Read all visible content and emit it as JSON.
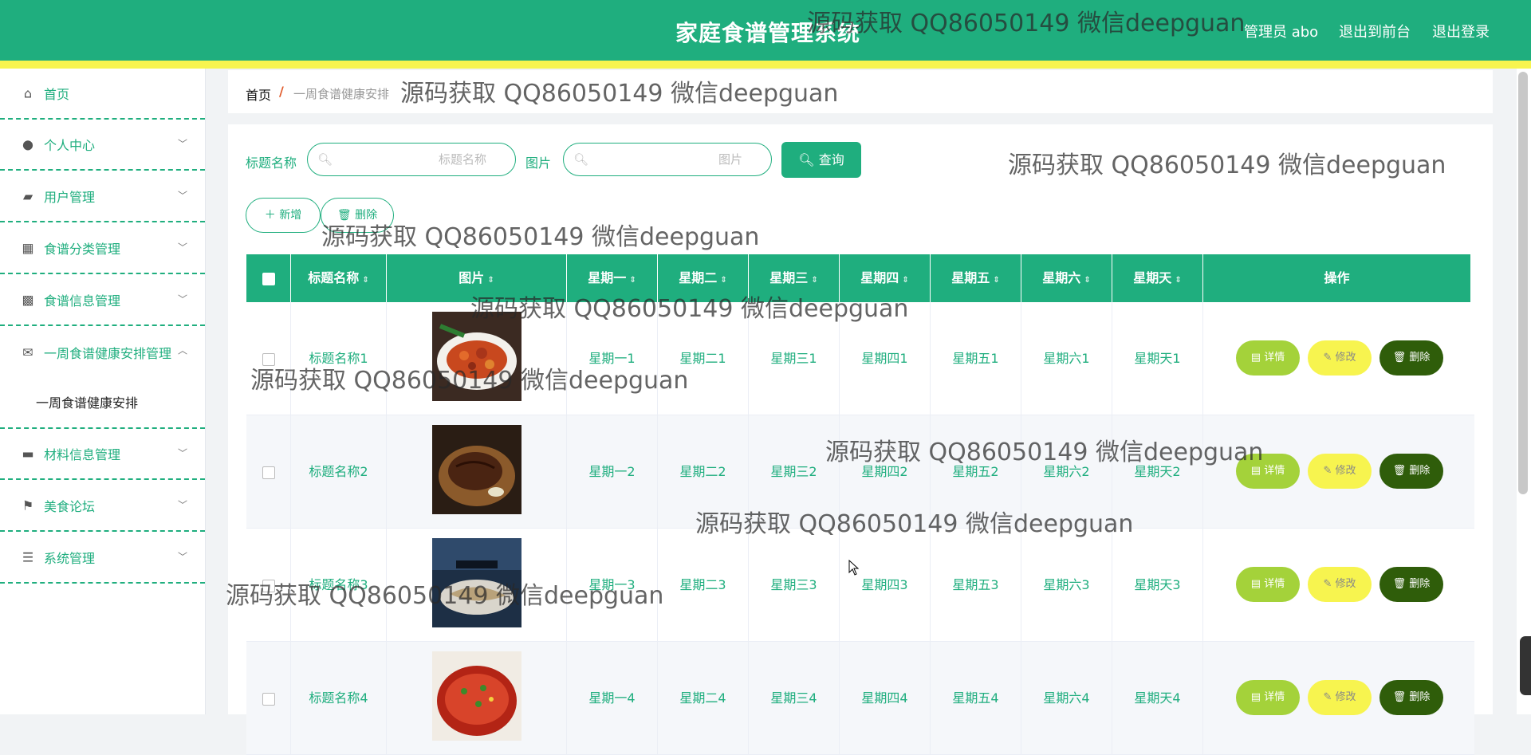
{
  "header": {
    "title": "家庭食谱管理系统",
    "admin": "管理员 abo",
    "to_front": "退出到前台",
    "logout": "退出登录"
  },
  "sidebar": {
    "items": [
      {
        "label": "首页",
        "icon": "home-icon"
      },
      {
        "label": "个人中心",
        "icon": "user-icon"
      },
      {
        "label": "用户管理",
        "icon": "wallet-icon"
      },
      {
        "label": "食谱分类管理",
        "icon": "grid-icon"
      },
      {
        "label": "食谱信息管理",
        "icon": "apps-icon"
      },
      {
        "label": "一周食谱健康安排管理",
        "icon": "mail-icon"
      },
      {
        "label": "材料信息管理",
        "icon": "briefcase-icon"
      },
      {
        "label": "美食论坛",
        "icon": "flag-icon"
      },
      {
        "label": "系统管理",
        "icon": "list-icon"
      }
    ],
    "submenu_active": "一周食谱健康安排"
  },
  "breadcrumb": {
    "home": "首页",
    "sep": "/",
    "current": "一周食谱健康安排"
  },
  "search": {
    "field1_label": "标题名称",
    "field1_placeholder": "标题名称",
    "field2_label": "图片",
    "field2_placeholder": "图片",
    "query": "查询"
  },
  "actions": {
    "add": "新增",
    "delete": "删除"
  },
  "table": {
    "headers": [
      "标题名称",
      "图片",
      "星期一",
      "星期二",
      "星期三",
      "星期四",
      "星期五",
      "星期六",
      "星期天",
      "操作"
    ],
    "rows": [
      {
        "title": "标题名称1",
        "mon": "星期一1",
        "tue": "星期二1",
        "wed": "星期三1",
        "thu": "星期四1",
        "fri": "星期五1",
        "sat": "星期六1",
        "sun": "星期天1"
      },
      {
        "title": "标题名称2",
        "mon": "星期一2",
        "tue": "星期二2",
        "wed": "星期三2",
        "thu": "星期四2",
        "fri": "星期五2",
        "sat": "星期六2",
        "sun": "星期天2"
      },
      {
        "title": "标题名称3",
        "mon": "星期一3",
        "tue": "星期二3",
        "wed": "星期三3",
        "thu": "星期四3",
        "fri": "星期五3",
        "sat": "星期六3",
        "sun": "星期天3"
      },
      {
        "title": "标题名称4",
        "mon": "星期一4",
        "tue": "星期二4",
        "wed": "星期三4",
        "thu": "星期四4",
        "fri": "星期五4",
        "sat": "星期六4",
        "sun": "星期天4"
      }
    ],
    "row_actions": {
      "detail": "详情",
      "edit": "修改",
      "delete": "删除"
    }
  },
  "watermark": "源码获取 QQ86050149 微信deepguan",
  "colors": {
    "primary": "#1fae7e",
    "yellow": "#f7f44f",
    "detail": "#a4d23a",
    "delete": "#2f5d0a"
  }
}
